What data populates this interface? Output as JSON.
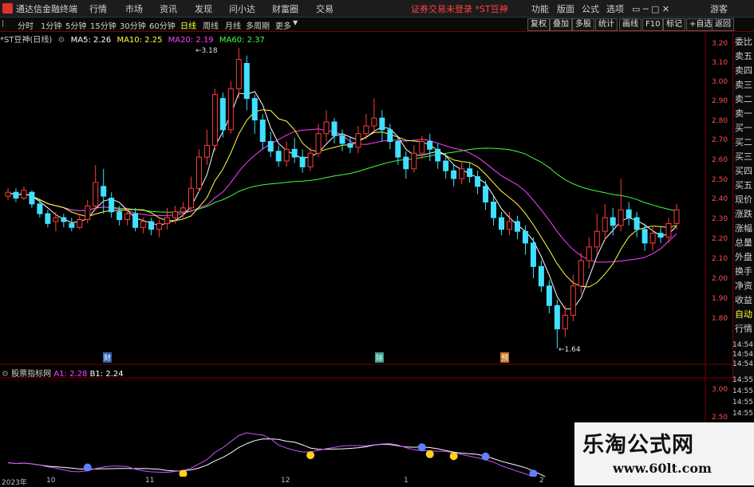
{
  "menubar": {
    "logo_text": "通达信金融终端",
    "items": [
      "行情",
      "市场",
      "资讯",
      "发现",
      "问小达",
      "财富圈",
      "交易"
    ],
    "notice": "证券交易未登录 *ST豆神",
    "right_items": [
      "功能",
      "版面",
      "公式",
      "选项"
    ],
    "guest": "游客"
  },
  "toolbar": {
    "periods": [
      "分时",
      "1分钟",
      "5分钟",
      "15分钟",
      "30分钟",
      "60分钟",
      "日线",
      "周线",
      "月线",
      "多周期",
      "更多"
    ],
    "active_period": "日线",
    "right_buttons": [
      "复权",
      "叠加",
      "多股",
      "统计",
      "画线",
      "F10",
      "标记",
      "+自选",
      "返回"
    ]
  },
  "legend": {
    "stock": "*ST豆神(日线)",
    "ma5": "MA5: 2.26",
    "ma10": "MA10: 2.25",
    "ma20": "MA20: 2.19",
    "ma60": "MA60: 2.37",
    "colors": {
      "ma5": "#ffffff",
      "ma10": "#ffff40",
      "ma20": "#ff40ff",
      "ma60": "#40ff40"
    }
  },
  "sub_legend": {
    "name": "股票指标网",
    "a1": "A1: 2.28",
    "b1": "B1: 2.24"
  },
  "price_ticks": [
    "3.20",
    "3.10",
    "3.00",
    "2.90",
    "2.80",
    "2.70",
    "2.60",
    "2.50",
    "2.40",
    "2.30",
    "2.20",
    "2.10",
    "2.00",
    "1.90",
    "1.80"
  ],
  "sub_ticks": [
    "3.00",
    "2.50"
  ],
  "annotations": {
    "high": "3.18",
    "low": "1.64"
  },
  "event_markers": [
    "财",
    "除",
    "预"
  ],
  "right_panel": {
    "labels": [
      "委比",
      "卖五",
      "卖四",
      "卖三",
      "卖二",
      "卖一",
      "买一",
      "买二",
      "买三",
      "买四",
      "买五",
      "现价",
      "涨跌",
      "涨幅",
      "总量",
      "外盘",
      "换手",
      "净资",
      "收益",
      "自动",
      "行情"
    ],
    "times": [
      "14:54",
      "14:54",
      "14:54",
      "14:55",
      "14:55",
      "14:55",
      "14:55",
      "14:56"
    ]
  },
  "bottom_axis": {
    "labels": [
      "2023年",
      "10",
      "11",
      "12",
      "1",
      "2"
    ]
  },
  "watermark": {
    "title": "乐淘公式网",
    "url": "www.60lt.com"
  },
  "chart_data": {
    "type": "candlestick",
    "ylim": [
      1.64,
      3.2
    ],
    "candles": [
      [
        2.42,
        2.44,
        2.4,
        2.46
      ],
      [
        2.44,
        2.41,
        2.39,
        2.46
      ],
      [
        2.41,
        2.45,
        2.4,
        2.47
      ],
      [
        2.44,
        2.38,
        2.36,
        2.45
      ],
      [
        2.38,
        2.33,
        2.31,
        2.4
      ],
      [
        2.33,
        2.28,
        2.26,
        2.35
      ],
      [
        2.29,
        2.31,
        2.24,
        2.34
      ],
      [
        2.31,
        2.29,
        2.26,
        2.33
      ],
      [
        2.28,
        2.26,
        2.24,
        2.31
      ],
      [
        2.26,
        2.3,
        2.25,
        2.33
      ],
      [
        2.3,
        2.37,
        2.28,
        2.4
      ],
      [
        2.37,
        2.49,
        2.35,
        2.58
      ],
      [
        2.47,
        2.42,
        2.33,
        2.56
      ],
      [
        2.41,
        2.34,
        2.31,
        2.44
      ],
      [
        2.34,
        2.3,
        2.27,
        2.37
      ],
      [
        2.3,
        2.33,
        2.27,
        2.36
      ],
      [
        2.33,
        2.26,
        2.24,
        2.36
      ],
      [
        2.26,
        2.29,
        2.23,
        2.31
      ],
      [
        2.29,
        2.25,
        2.22,
        2.31
      ],
      [
        2.25,
        2.28,
        2.21,
        2.3
      ],
      [
        2.28,
        2.31,
        2.25,
        2.36
      ],
      [
        2.31,
        2.34,
        2.28,
        2.37
      ],
      [
        2.34,
        2.36,
        2.31,
        2.39
      ],
      [
        2.36,
        2.46,
        2.34,
        2.52
      ],
      [
        2.46,
        2.62,
        2.44,
        2.66
      ],
      [
        2.62,
        2.68,
        2.58,
        2.76
      ],
      [
        2.68,
        2.94,
        2.65,
        2.97
      ],
      [
        2.92,
        2.76,
        2.72,
        2.95
      ],
      [
        2.76,
        2.97,
        2.74,
        3.01
      ],
      [
        2.97,
        3.12,
        2.92,
        3.18
      ],
      [
        3.1,
        2.92,
        2.86,
        3.14
      ],
      [
        2.92,
        2.81,
        2.74,
        2.94
      ],
      [
        2.81,
        2.7,
        2.66,
        2.84
      ],
      [
        2.7,
        2.65,
        2.62,
        2.75
      ],
      [
        2.65,
        2.6,
        2.57,
        2.68
      ],
      [
        2.6,
        2.66,
        2.57,
        2.7
      ],
      [
        2.66,
        2.62,
        2.59,
        2.72
      ],
      [
        2.62,
        2.57,
        2.54,
        2.66
      ],
      [
        2.57,
        2.64,
        2.55,
        2.67
      ],
      [
        2.64,
        2.74,
        2.62,
        2.79
      ],
      [
        2.74,
        2.8,
        2.7,
        2.86
      ],
      [
        2.8,
        2.73,
        2.69,
        2.82
      ],
      [
        2.73,
        2.69,
        2.65,
        2.76
      ],
      [
        2.69,
        2.67,
        2.64,
        2.72
      ],
      [
        2.67,
        2.74,
        2.64,
        2.78
      ],
      [
        2.74,
        2.78,
        2.71,
        2.84
      ],
      [
        2.78,
        2.82,
        2.75,
        2.92
      ],
      [
        2.82,
        2.76,
        2.7,
        2.86
      ],
      [
        2.76,
        2.7,
        2.66,
        2.79
      ],
      [
        2.7,
        2.62,
        2.58,
        2.72
      ],
      [
        2.62,
        2.56,
        2.51,
        2.65
      ],
      [
        2.56,
        2.64,
        2.54,
        2.68
      ],
      [
        2.64,
        2.7,
        2.61,
        2.73
      ],
      [
        2.7,
        2.66,
        2.6,
        2.74
      ],
      [
        2.66,
        2.6,
        2.56,
        2.69
      ],
      [
        2.6,
        2.55,
        2.51,
        2.64
      ],
      [
        2.55,
        2.51,
        2.47,
        2.58
      ],
      [
        2.51,
        2.56,
        2.48,
        2.6
      ],
      [
        2.56,
        2.52,
        2.49,
        2.59
      ],
      [
        2.52,
        2.47,
        2.43,
        2.55
      ],
      [
        2.47,
        2.39,
        2.35,
        2.5
      ],
      [
        2.39,
        2.31,
        2.27,
        2.42
      ],
      [
        2.31,
        2.25,
        2.22,
        2.34
      ],
      [
        2.25,
        2.29,
        2.22,
        2.34
      ],
      [
        2.29,
        2.24,
        2.2,
        2.32
      ],
      [
        2.24,
        2.18,
        2.12,
        2.27
      ],
      [
        2.18,
        2.06,
        2.0,
        2.21
      ],
      [
        2.06,
        1.96,
        1.93,
        2.09
      ],
      [
        1.96,
        1.86,
        1.82,
        1.99
      ],
      [
        1.86,
        1.74,
        1.64,
        1.89
      ],
      [
        1.74,
        1.81,
        1.7,
        1.86
      ],
      [
        1.81,
        1.96,
        1.78,
        2.02
      ],
      [
        1.96,
        2.09,
        1.92,
        2.13
      ],
      [
        2.09,
        2.16,
        2.05,
        2.21
      ],
      [
        2.16,
        2.24,
        2.12,
        2.33
      ],
      [
        2.24,
        2.31,
        2.19,
        2.38
      ],
      [
        2.31,
        2.27,
        2.22,
        2.36
      ],
      [
        2.27,
        2.35,
        2.24,
        2.51
      ],
      [
        2.35,
        2.31,
        2.27,
        2.39
      ],
      [
        2.31,
        2.25,
        2.21,
        2.34
      ],
      [
        2.25,
        2.18,
        2.14,
        2.28
      ],
      [
        2.18,
        2.23,
        2.14,
        2.27
      ],
      [
        2.23,
        2.21,
        2.18,
        2.26
      ],
      [
        2.21,
        2.28,
        2.18,
        2.31
      ],
      [
        2.28,
        2.35,
        2.25,
        2.38
      ]
    ]
  }
}
